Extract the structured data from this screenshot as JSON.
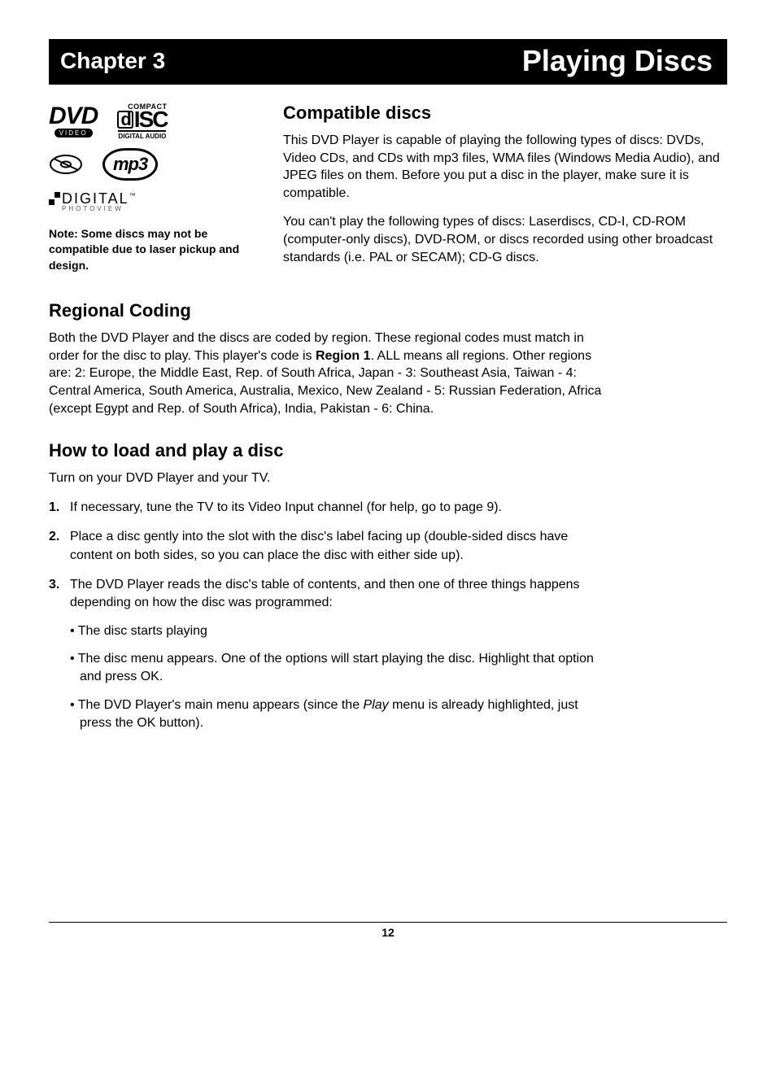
{
  "header": {
    "chapter": "Chapter 3",
    "title": "Playing Discs"
  },
  "logos": {
    "dvd_top": "DVD",
    "dvd_bottom": "VIDEO",
    "cd_compact": "COMPACT",
    "cd_disc": "DISC",
    "cd_digital_audio": "DIGITAL AUDIO",
    "mp3": "mp3",
    "digital_big": "DIGITAL",
    "digital_small": "PHOTOVIEW",
    "digital_tm": "™"
  },
  "note": "Note: Some discs may not be compatible due to laser pickup and design.",
  "compatible": {
    "heading": "Compatible discs",
    "p1": "This DVD Player is capable of playing the following types of discs: DVDs, Video CDs, and CDs with mp3 files, WMA files (Windows Media Audio), and JPEG files on them. Before you put a disc in the player, make sure it is compatible.",
    "p2": "You can't play the following types of discs: Laserdiscs, CD-I, CD-ROM (computer-only discs), DVD-ROM, or discs recorded using other broadcast standards (i.e. PAL or SECAM); CD-G discs."
  },
  "regional": {
    "heading": "Regional Coding",
    "p_before_bold": "Both the DVD Player and the discs are coded by region. These regional codes must match in order for the disc to play. This player's code is ",
    "bold": "Region 1",
    "p_after_bold": ". ALL means all regions. Other regions are: 2: Europe, the Middle East, Rep. of South Africa, Japan - 3: Southeast Asia, Taiwan - 4: Central America, South America, Australia, Mexico, New Zealand - 5: Russian Federation, Africa (except Egypt and Rep. of South Africa), India, Pakistan - 6: China."
  },
  "howto": {
    "heading": "How to load and play a disc",
    "intro": "Turn on your DVD Player and your TV.",
    "steps": [
      "If necessary, tune the TV to its Video Input channel (for help, go to page 9).",
      "Place a disc gently into the slot with the disc's label facing up (double-sided discs have content on both sides, so you can place the disc with either side up).",
      "The DVD Player reads the disc's table of contents, and then one of three things happens depending on how the disc was programmed:"
    ],
    "bullets": {
      "b1": "The disc starts playing",
      "b2": "The disc menu appears. One of the options will start playing the disc. Highlight that option and press OK.",
      "b3_before": "The DVD Player's main menu appears (since the ",
      "b3_em": "Play",
      "b3_after": " menu is already highlighted, just press the OK button)."
    },
    "step_numbers": [
      "1.",
      "2.",
      "3."
    ]
  },
  "page_number": "12"
}
